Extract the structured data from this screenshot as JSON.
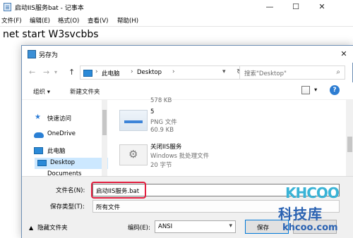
{
  "notepad": {
    "title": "启动IIS服务bat - 记事本",
    "controls": [
      "—",
      "☐",
      "✕"
    ],
    "menus": [
      "文件(F)",
      "编辑(E)",
      "格式(O)",
      "查看(V)",
      "帮助(H)"
    ],
    "content": "net start W3svcbbs"
  },
  "dialog": {
    "title": "另存为",
    "close": "✕",
    "nav": {
      "back": "←",
      "forward": "→",
      "up": "↑",
      "refresh": "↻"
    },
    "address": [
      "此电脑",
      "Desktop"
    ],
    "search_placeholder": "搜索\"Desktop\"",
    "toolbar": {
      "organize": "组织 ▾",
      "new_folder": "新建文件夹",
      "help": "?"
    },
    "left_pane": [
      "快速访问",
      "OneDrive",
      "此电脑",
      "Desktop",
      "Documents"
    ],
    "files": [
      {
        "name": "5",
        "type": "PNG 文件",
        "size": "60.9 KB"
      },
      {
        "name": "关闭IIS服务",
        "type": "Windows 批处理文件",
        "size": "20 字节"
      }
    ],
    "partial_text": "578 KB",
    "filename_label": "文件名(N):",
    "filename_value": "启动IIS服务.bat",
    "filetype_label": "保存类型(T):",
    "filetype_value": "所有文件",
    "hide_folders": "隐藏文件夹",
    "encoding_label": "编码(E):",
    "encoding_value": "ANSI",
    "save_button": "保存"
  },
  "watermark": {
    "brand": "KHCOO",
    "chinese": "科技库",
    "url": "khcoo.com"
  },
  "colors": {
    "accent": "#0078d7",
    "highlight": "#e21d3e",
    "selection": "#cce8ff",
    "watermark_blue": "#2a62b2",
    "watermark_cyan": "#39b3d6"
  }
}
